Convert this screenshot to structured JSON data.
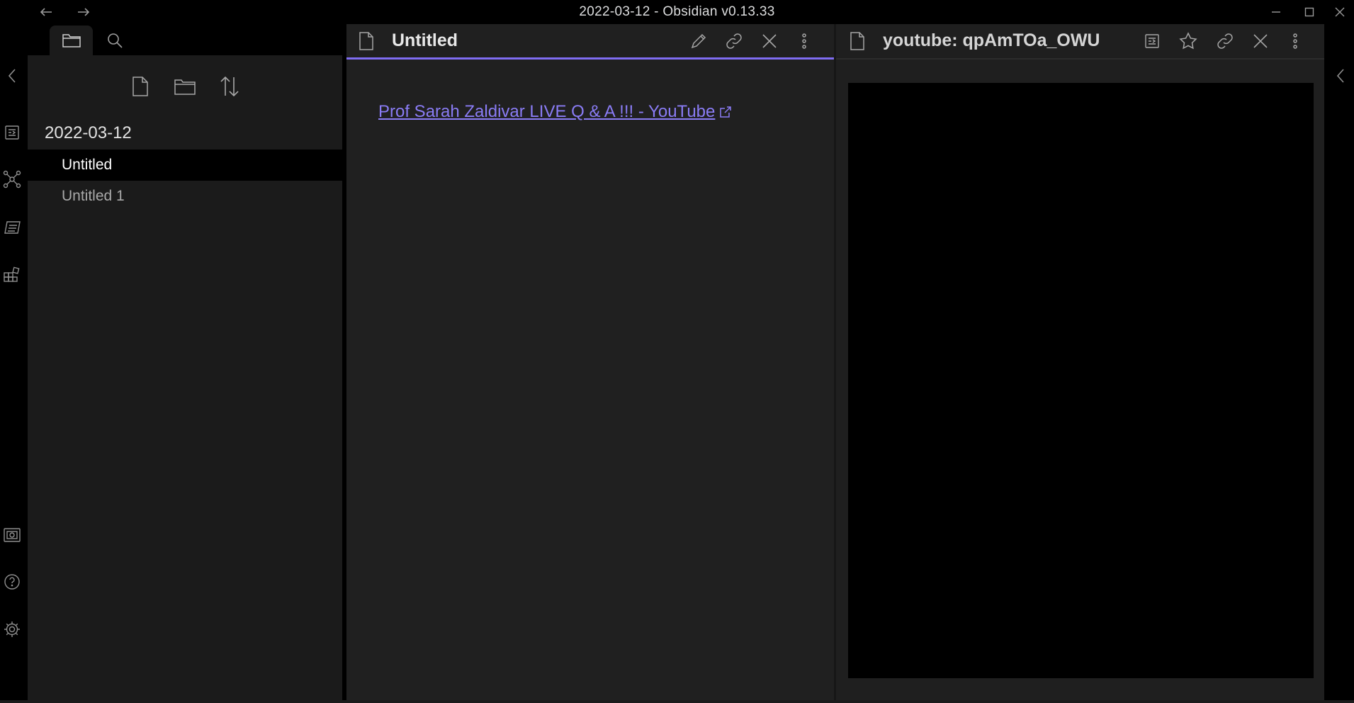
{
  "window": {
    "title": "2022-03-12 - Obsidian v0.13.33",
    "nav": [
      "back-arrow-icon",
      "forward-arrow-icon"
    ],
    "controls": [
      "minimize-icon",
      "maximize-icon",
      "close-icon"
    ]
  },
  "ribbon": {
    "top_icons": [
      "open-quick-switcher-icon",
      "graph-view-icon",
      "open-command-palette-icon",
      "insert-template-icon"
    ],
    "bottom_icons": [
      "open-vault-icon",
      "help-icon",
      "settings-icon"
    ]
  },
  "sidebar": {
    "tabs": [
      "file-explorer-icon",
      "search-icon"
    ],
    "actions": [
      "new-note-icon",
      "new-folder-icon",
      "sort-icon"
    ],
    "folder": "2022-03-12",
    "files": [
      {
        "name": "Untitled",
        "active": true
      },
      {
        "name": "Untitled 1",
        "active": false
      }
    ]
  },
  "editor": {
    "title": "Untitled",
    "actions": [
      "edit-pencil-icon",
      "link-icon",
      "close-icon",
      "more-options-icon"
    ],
    "link_text": "Prof Sarah Zaldivar LIVE Q & A !!! - YouTube"
  },
  "webview": {
    "title": "youtube: qpAmTOa_OWU",
    "actions": [
      "quick-switcher-icon",
      "star-icon",
      "link-icon",
      "close-icon",
      "more-options-icon"
    ]
  },
  "colors": {
    "accent": "#7f6df2",
    "link": "#8a7cf5",
    "background": "#000000",
    "sidebar": "#1b1b1b",
    "pane": "#202020"
  }
}
